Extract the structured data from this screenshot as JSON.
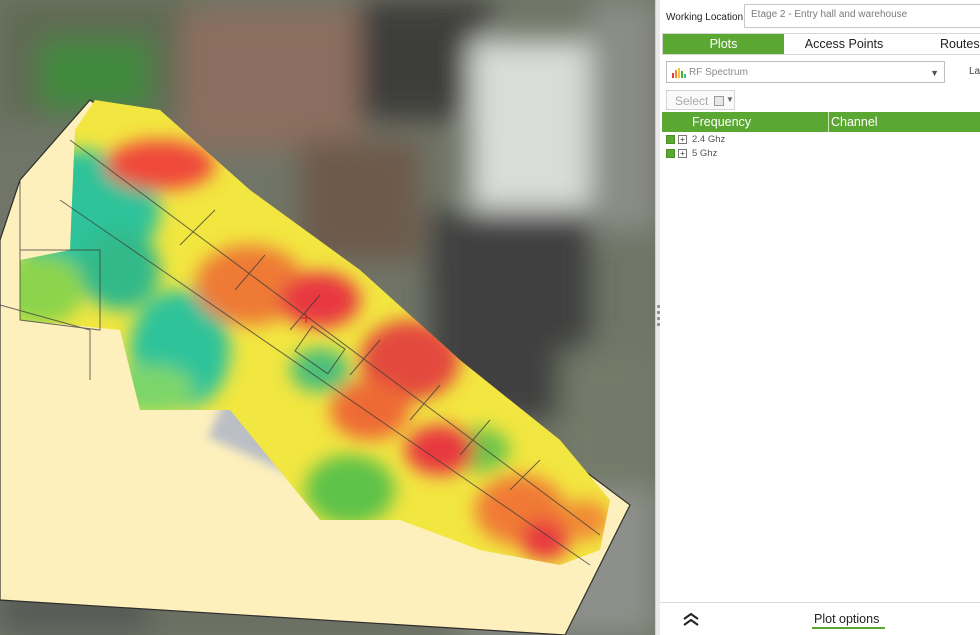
{
  "working_location": {
    "label": "Working Location:",
    "value": "Etage 2 - Entry hall and warehouse"
  },
  "tabs": [
    {
      "label": "Plots",
      "active": true
    },
    {
      "label": "Access Points",
      "active": false
    },
    {
      "label": "Routes",
      "active": false
    }
  ],
  "plot_dropdown": {
    "icon": "rf-spectrum-icon",
    "value": "RF Spectrum"
  },
  "layers_label_partial": "Lay",
  "select_button": {
    "label": "Select"
  },
  "grid": {
    "columns": [
      "Frequency",
      "Channel"
    ],
    "rows": [
      {
        "label": "2.4 Ghz",
        "checked": true
      },
      {
        "label": "5 Ghz",
        "checked": true
      }
    ]
  },
  "bottom": {
    "plot_options_label": "Plot options"
  },
  "colors": {
    "accent": "#5aa832",
    "floor_plan": "#fdf0bd",
    "heat_low": "#2ec39a",
    "heat_mid": "#f2e640",
    "heat_high": "#e8383f"
  }
}
